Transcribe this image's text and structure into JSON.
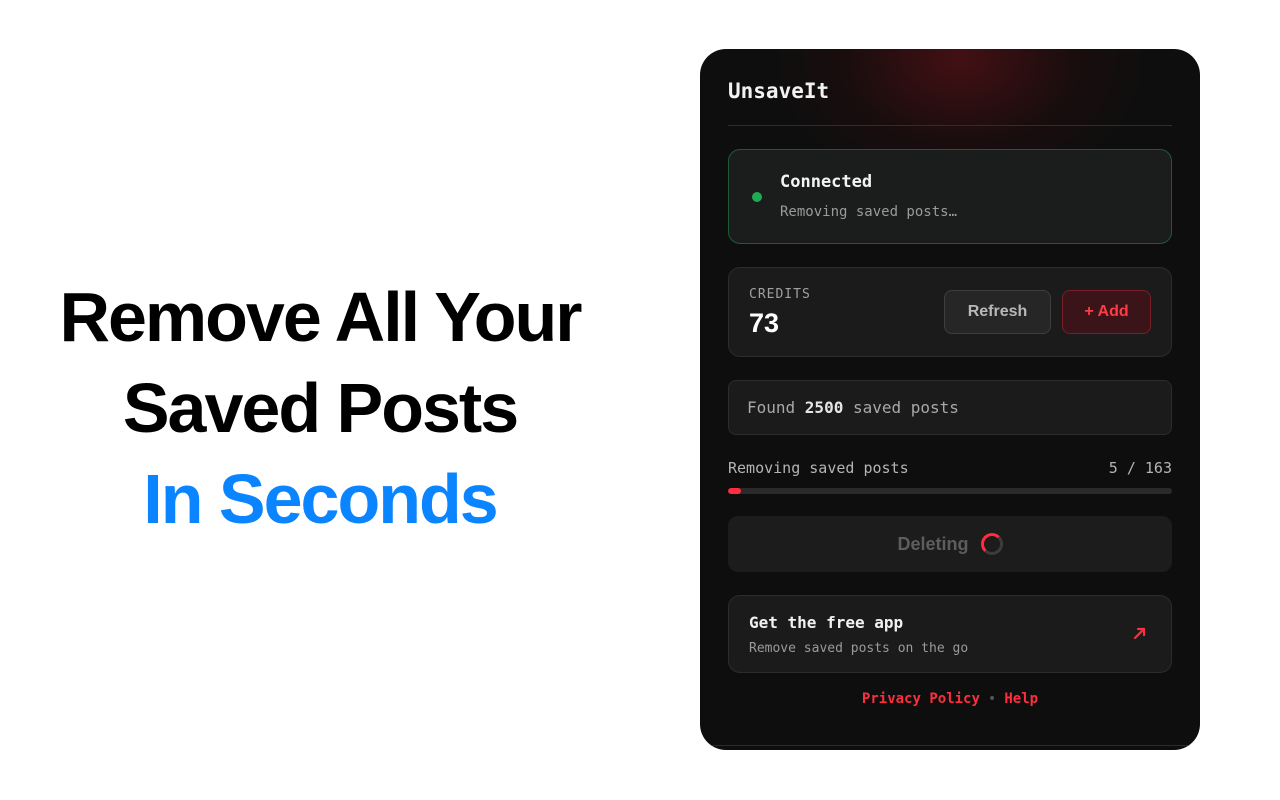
{
  "hero": {
    "line1": "Remove All Your",
    "line2": "Saved Posts",
    "line3": "In Seconds",
    "accent_color": "#0a84ff"
  },
  "panel": {
    "app_title": "UnsaveIt",
    "status": {
      "title": "Connected",
      "subtitle": "Removing saved posts…",
      "color": "#1faa55"
    },
    "credits": {
      "label": "CREDITS",
      "value": "73",
      "refresh_label": "Refresh",
      "add_label": "+ Add"
    },
    "found": {
      "prefix": "Found ",
      "count": "2500",
      "suffix": " saved posts"
    },
    "progress": {
      "label": "Removing saved posts",
      "current": 5,
      "total": 163,
      "count_text": "5 / 163",
      "fill_fraction": 0.03,
      "color": "#ff2d3d"
    },
    "delete_button": {
      "label": "Deleting",
      "icon": "spinner-icon"
    },
    "app_promo": {
      "title": "Get the free app",
      "subtitle": "Remove saved posts on the go",
      "icon": "external-arrow-icon"
    },
    "footer": {
      "privacy": "Privacy Policy",
      "separator": "•",
      "help": "Help"
    }
  }
}
